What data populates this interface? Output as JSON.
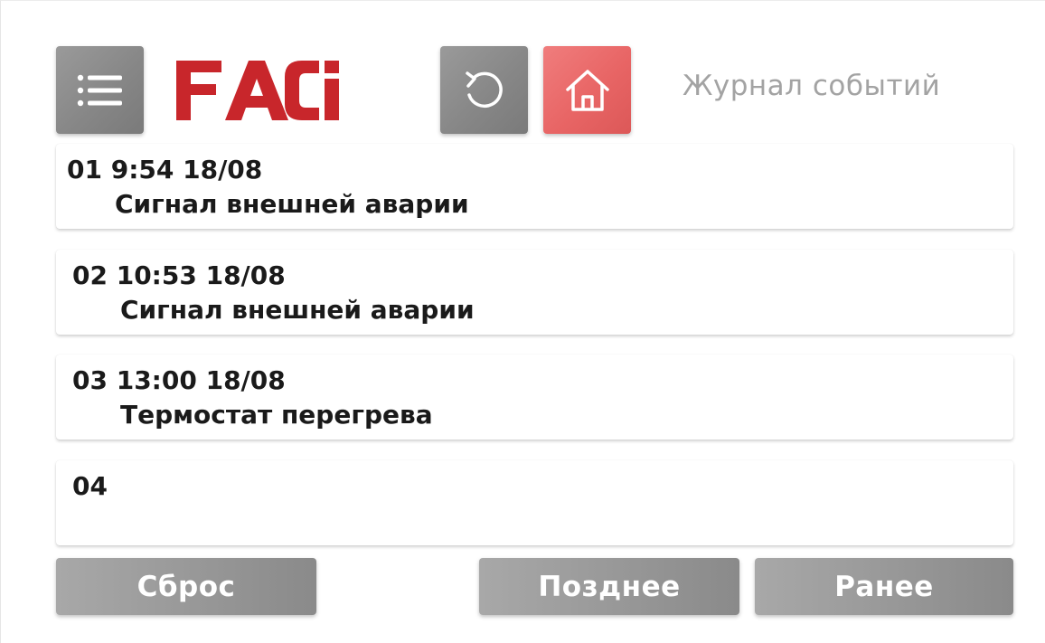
{
  "header": {
    "logo_text": "FACi",
    "title": "Журнал событий",
    "menu_icon": "list-menu-icon",
    "refresh_icon": "refresh-icon",
    "home_icon": "home-icon"
  },
  "colors": {
    "brand_red": "#c8262b",
    "home_button": "#e86565",
    "tile_grey": "#878787",
    "title_grey": "#a3a3a3"
  },
  "events": [
    {
      "head": "01 9:54 18/08",
      "desc": "Сигнал внешней аварии"
    },
    {
      "head": "02 10:53 18/08",
      "desc": "Сигнал внешней аварии"
    },
    {
      "head": "03 13:00 18/08",
      "desc": "Термостат перегрева"
    },
    {
      "head": "04",
      "desc": ""
    }
  ],
  "buttons": {
    "reset": "Сброс",
    "later": "Позднее",
    "earlier": "Ранее"
  }
}
